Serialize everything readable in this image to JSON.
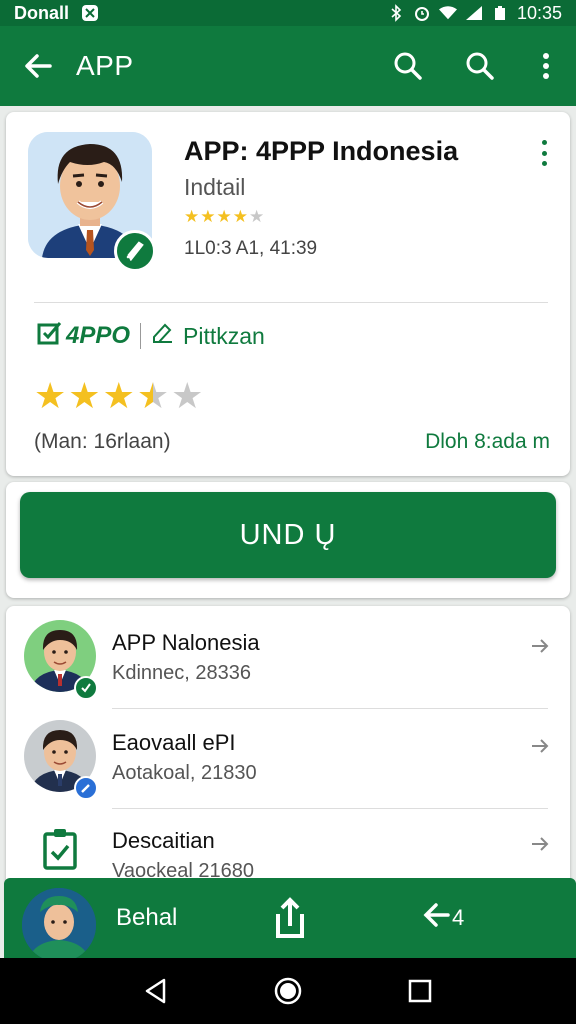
{
  "status_bar": {
    "carrier": "Donall",
    "time": "10:35",
    "icons": [
      "bluetooth-icon",
      "alarm-icon",
      "wifi-icon",
      "signal-icon",
      "battery-icon"
    ]
  },
  "app_bar": {
    "title": "APP",
    "icons": [
      "back-arrow-icon",
      "search-icon",
      "search-icon",
      "more-vert-icon"
    ]
  },
  "app_card": {
    "name": "APP: 4PPP Indonesia",
    "subtitle": "Indtail",
    "small_rating": 4,
    "meta": "1L0:3 A1, 41:39",
    "tag_app": "4PPO",
    "tag_publisher": "Pittkzan",
    "big_rating": 3.5,
    "rating_caption": "(Man: 16rlaan)",
    "rating_link": "Dloh 8:ada m"
  },
  "install_button": {
    "label": "UND Ų"
  },
  "list": [
    {
      "title": "APP Nalonesia",
      "subtitle": "Kdinnec, 28336",
      "badge_icon": "check-icon"
    },
    {
      "title": "Eaovaall ePI",
      "subtitle": "Aotakoal, 21830",
      "badge_icon": "edit-icon"
    },
    {
      "title": "Descaitian",
      "subtitle": "Vaockeal 21680",
      "badge_icon": "clipboard-check-icon"
    }
  ],
  "bottom_bar": {
    "label": "Behal",
    "back_count": "4"
  },
  "colors": {
    "primary": "#0f7a3e",
    "status_bar": "#0b6b36",
    "star": "#f4c020",
    "star_empty": "#c8c8c8"
  }
}
